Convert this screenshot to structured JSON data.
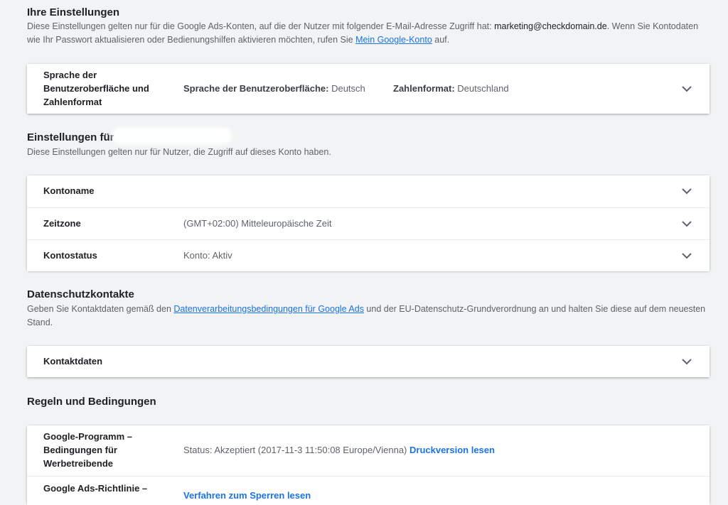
{
  "your_settings": {
    "title": "Ihre Einstellungen",
    "desc_part1": "Diese Einstellungen gelten nur für die Google Ads-Konten, auf die der Nutzer mit folgender E-Mail-Adresse Zugriff hat: ",
    "email": "marketing@checkdomain.de",
    "desc_part2": ". Wenn Sie Kontodaten wie Ihr Passwort aktualisieren oder Bedienungshilfen aktivieren möchten, rufen Sie ",
    "link": "Mein Google-Konto",
    "desc_part3": " auf.",
    "language_row": {
      "label": "Sprache der Benutzeroberfläche und Zahlenformat",
      "ui_lang_key": "Sprache der Benutzeroberfläche:",
      "ui_lang_value": "Deutsch",
      "number_format_key": "Zahlenformat:",
      "number_format_value": "Deutschland"
    }
  },
  "account_settings": {
    "title": "Einstellungen für",
    "desc": "Diese Einstellungen gelten nur für Nutzer, die Zugriff auf dieses Konto haben.",
    "rows": [
      {
        "label": "Kontoname",
        "value": ""
      },
      {
        "label": "Zeitzone",
        "value": "(GMT+02:00) Mitteleuropäische Zeit"
      },
      {
        "label": "Kontostatus",
        "value": "Konto: Aktiv"
      }
    ]
  },
  "privacy": {
    "title": "Datenschutzkontakte",
    "desc_part1": "Geben Sie Kontaktdaten gemäß den ",
    "link": "Datenverarbeitungsbedingungen für Google Ads",
    "desc_part2": " und der EU-Datenschutz-Grundverordnung an und halten Sie diese auf dem neuesten Stand.",
    "row_label": "Kontaktdaten"
  },
  "terms": {
    "title": "Regeln und Bedingungen",
    "rows": [
      {
        "label": "Google-Programm – Bedingungen für Werbetreibende",
        "status": "Status: Akzeptiert (2017-11-3 11:50:08 Europe/Vienna)",
        "link": "Druckversion lesen"
      },
      {
        "label": "Google Ads-Richtlinie –",
        "link": "Verfahren zum Sperren lesen"
      }
    ]
  },
  "colors": {
    "background": "#f1f3f4",
    "link": "#1a73e8",
    "text": "#202124",
    "secondary": "#5f6368"
  }
}
